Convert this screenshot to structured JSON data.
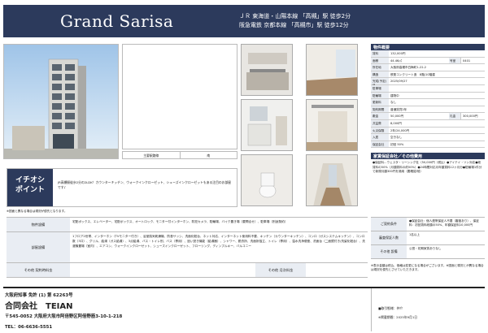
{
  "header": {
    "title": "Grand Sarisa",
    "access_line1": "ＪＲ 東海道・山陽本線 「高槻」駅 徒歩2分",
    "access_line2": "阪急電鉄 京都本線 「高槻市」駅 徒歩12分"
  },
  "map_caption": {
    "left": "主要駅路線",
    "right": "南"
  },
  "spec": {
    "heading": "物件概要",
    "rows": [
      {
        "k": "賃料",
        "v": "132,000円"
      },
      {
        "k": "面積",
        "v": "44.46㎡",
        "k2": "号室",
        "v2": "0401"
      },
      {
        "k": "所在地",
        "v": "大阪府高槻市白梅町1-22-2"
      },
      {
        "k": "構造",
        "v": "鉄筋コンクリート造　8階/10階建"
      },
      {
        "k": "完成(予定)日",
        "v": "2025/09/27"
      },
      {
        "k": "駐車場",
        "v": ""
      },
      {
        "k": "駐輪場",
        "v": "建物中"
      },
      {
        "k": "更新料",
        "v": "なし"
      },
      {
        "k": "契約期間",
        "v": "普通賃貸2年"
      },
      {
        "k": "敷金",
        "v": "50,000円",
        "k2": "礼金",
        "v2": "300,000円"
      },
      {
        "k": "共益費",
        "v": "8,000円"
      },
      {
        "k": "火災保険",
        "v": "2年/24,000円"
      },
      {
        "k": "入居",
        "v": "空きなし"
      },
      {
        "k": "保証会社",
        "v": "初回 50%"
      }
    ]
  },
  "features": {
    "heading": "家賃保証会社／その他費用",
    "body": "●保証料…ウェスタ・リーシング社（50,000円（税込）●アイテイ・ソン対応●総賃料の50%（月額賃料の約50%）●24時間対応月年額賃料12ヶ月分●駐輪場1件分で新規月額300円を適用（要確認/他）"
  },
  "reco": {
    "label_line1": "イチオシ",
    "label_line2": "ポイント",
    "text": "JR高槻駅徒歩2分の2LDK！カウンターキッチン、ウォークインクローゼット、シューズインクローゼットもある注目のお部屋です♪"
  },
  "note1": "※図面と異なる場合は現況が優先となります。",
  "lower": {
    "rows": [
      {
        "k": "物件設備",
        "v": "宅配ボックス、エレベーター、宅配ボックス、オートロック、モニター付インターホン、防犯カメラ、駐輪場、バイク置き場（要問合せ）、駐車場（別途契約）"
      },
      {
        "k": "部屋設備",
        "v": "1フロア2世帯、インターホン（TVモニター付き）、浴室換気乾燥機、防音サッシ、洗面化粧台、ネット対応、インターネット使用料不要、キッチン（カウンターキッチン）、コンロ（ガスシステムキッチン）、コンロ数（3口）、グリル、給湯（ガス給湯）、3点給湯、バス・トイレ別、バス（専用）、追い焚き機能（給湯器）、シャワー、脱衣所、洗面所独立、トイレ（専用）、温水洗浄便座、洗面台（二面鏡付き/洗髪化粧台）、洗濯機置場（室内）、エアコン、ウォークインクローゼット、シューズインクローゼット、フローリング、ディンプルキー、バルコニー"
      },
      {
        "k": "その他 契約時料金",
        "v": "",
        "k3": "その他 月次料金",
        "v3": ""
      }
    ]
  },
  "right_table": {
    "rows": [
      {
        "k": "ご契約条件",
        "v": "●保証会社：個人連帯保証人不要（審査あり）、保証料：初回賃料総額の50%、年額保証料10,000円"
      },
      {
        "k": "審査保証人数",
        "v": "1名以上"
      },
      {
        "k": "その他 設備",
        "v": "公営・初期家賃ありなし"
      }
    ]
  },
  "notes2": "※表示金額は税込、価格は変更になる場合がございます。※図面と現況とが異なる場合は現況を優先とさせていただきます。",
  "footer": {
    "license": "大阪府知事 免許 (1) 第 62263号",
    "company": "合同会社　TEIAN",
    "address": "〒545-0052 大阪府大阪市阿倍野区阿倍野筋3-10-1-218",
    "tel": "TEL：06-6636-5551",
    "right_a": "■取引態様：仲介",
    "right_b": "※掲載期間：2025年9月1日"
  },
  "colors": {
    "navy": "#2c3a5c",
    "label_bg": "#e9edf3"
  }
}
